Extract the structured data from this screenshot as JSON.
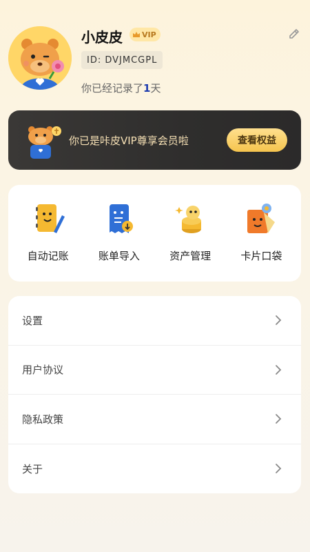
{
  "profile": {
    "username": "小皮皮",
    "vip_badge": "VIP",
    "user_id": "ID: DVJMCGPL",
    "record_prefix": "你已经记录了",
    "record_days": "1",
    "record_suffix": "天"
  },
  "vip_banner": {
    "text": "你已是咔皮VIP尊享会员啦",
    "button_label": "查看权益"
  },
  "shortcuts": [
    {
      "label": "自动记账",
      "icon": "auto-bookkeeping-icon"
    },
    {
      "label": "账单导入",
      "icon": "bill-import-icon"
    },
    {
      "label": "资产管理",
      "icon": "asset-management-icon"
    },
    {
      "label": "卡片口袋",
      "icon": "card-pocket-icon"
    }
  ],
  "menu": [
    {
      "label": "设置"
    },
    {
      "label": "用户协议"
    },
    {
      "label": "隐私政策"
    },
    {
      "label": "关于"
    }
  ],
  "colors": {
    "accent_gold": "#f5c44e",
    "banner_dark": "#2f2e2d",
    "days_blue": "#1e3cae"
  }
}
